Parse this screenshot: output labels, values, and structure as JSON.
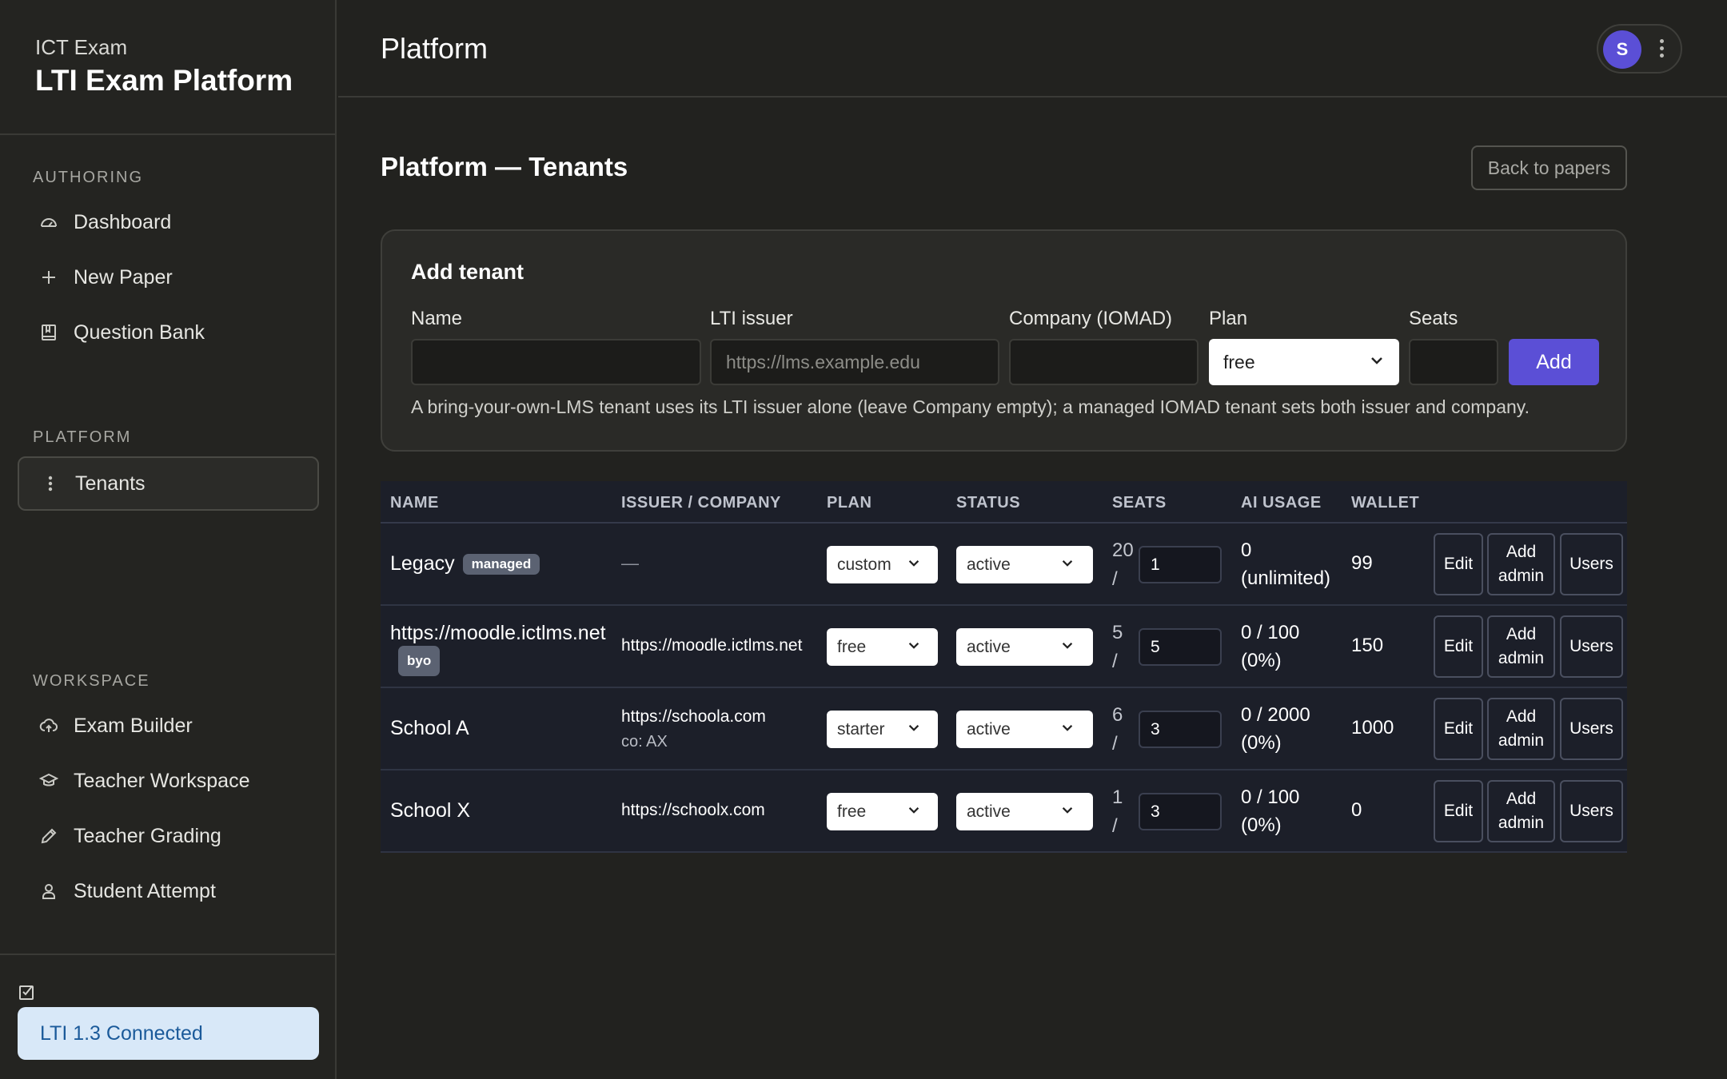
{
  "brand": {
    "subtitle": "ICT Exam",
    "title": "LTI Exam Platform"
  },
  "sidebar": {
    "authoring_label": "AUTHORING",
    "authoring_items": [
      {
        "label": "Dashboard",
        "icon": "gauge-icon"
      },
      {
        "label": "New Paper",
        "icon": "plus-icon"
      },
      {
        "label": "Question Bank",
        "icon": "book-icon"
      }
    ],
    "platform_label": "PLATFORM",
    "platform_items": [
      {
        "label": "Tenants",
        "icon": "kebab-icon",
        "active": true
      }
    ],
    "workspace_label": "WORKSPACE",
    "workspace_items": [
      {
        "label": "Exam Builder",
        "icon": "cloud-upload-icon"
      },
      {
        "label": "Teacher Workspace",
        "icon": "graduation-cap-icon"
      },
      {
        "label": "Teacher Grading",
        "icon": "pencil-icon"
      },
      {
        "label": "Student Attempt",
        "icon": "user-icon"
      }
    ],
    "status": "LTI 1.3 Connected"
  },
  "topbar": {
    "title": "Platform",
    "avatar_initial": "S"
  },
  "page": {
    "title": "Platform — Tenants",
    "back_label": "Back to papers"
  },
  "add_tenant": {
    "title": "Add tenant",
    "name_label": "Name",
    "issuer_label": "LTI issuer",
    "issuer_placeholder": "https://lms.example.edu",
    "company_label": "Company (IOMAD)",
    "plan_label": "Plan",
    "plan_value": "free",
    "seats_label": "Seats",
    "add_label": "Add",
    "hint": "A bring-your-own-LMS tenant uses its LTI issuer alone (leave Company empty); a managed IOMAD tenant sets both issuer and company."
  },
  "table": {
    "headers": [
      "NAME",
      "ISSUER / COMPANY",
      "PLAN",
      "STATUS",
      "SEATS",
      "AI USAGE",
      "WALLET"
    ],
    "actions": {
      "edit": "Edit",
      "add_admin_1": "Add",
      "add_admin_2": "admin",
      "users": "Users"
    },
    "rows": [
      {
        "name": "Legacy",
        "badge": "managed",
        "issuer": "—",
        "company": "",
        "plan": "custom",
        "status": "active",
        "seats_used": "20",
        "seats_sep": "/",
        "seats_limit": "1",
        "ai_1": "0",
        "ai_2": "(unlimited)",
        "wallet": "99"
      },
      {
        "name": "https://moodle.ictlms.net",
        "badge": "byo",
        "issuer": "https://moodle.ictlms.net",
        "company": "",
        "plan": "free",
        "status": "active",
        "seats_used": "5",
        "seats_sep": "/",
        "seats_limit": "5",
        "ai_1": "0 / 100",
        "ai_2": "(0%)",
        "wallet": "150"
      },
      {
        "name": "School A",
        "badge": "",
        "issuer": "https://schoola.com",
        "company": "co: AX",
        "plan": "starter",
        "status": "active",
        "seats_used": "6",
        "seats_sep": "/",
        "seats_limit": "3",
        "ai_1": "0 / 2000",
        "ai_2": "(0%)",
        "wallet": "1000"
      },
      {
        "name": "School X",
        "badge": "",
        "issuer": "https://schoolx.com",
        "company": "",
        "plan": "free",
        "status": "active",
        "seats_used": "1",
        "seats_sep": "/",
        "seats_limit": "3",
        "ai_1": "0 / 100",
        "ai_2": "(0%)",
        "wallet": "0"
      }
    ]
  }
}
